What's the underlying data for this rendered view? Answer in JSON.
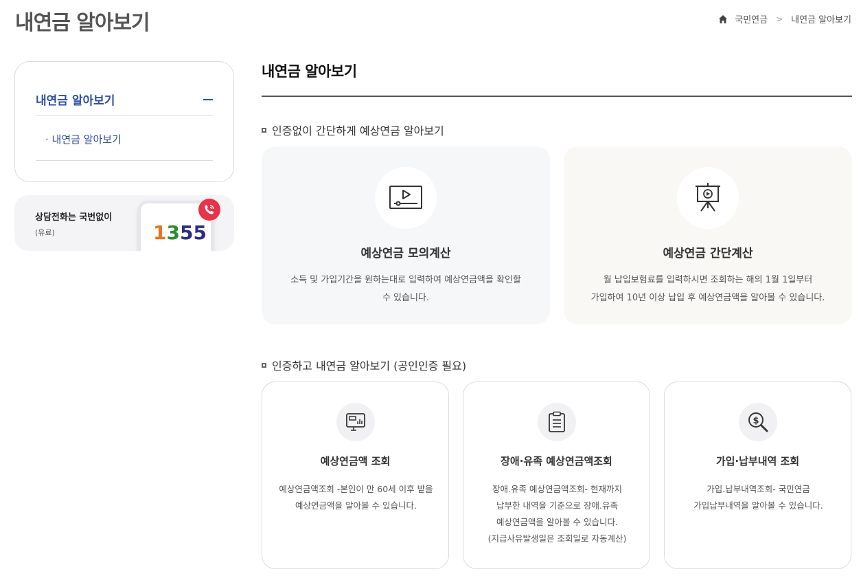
{
  "header": {
    "title": "내연금 알아보기",
    "breadcrumb": {
      "home_icon": "home-icon",
      "level1": "국민연금",
      "separator": ">",
      "level2": "내연금 알아보기"
    }
  },
  "sidebar": {
    "menu_title": "내연금 알아보기",
    "collapse_icon": "minus-icon",
    "sub_item": "· 내연금 알아보기"
  },
  "call_box": {
    "line1": "상담전화는 국번없이",
    "line2": "(유료)",
    "number_part1": "1",
    "number_part2": "3",
    "number_part3": "55",
    "icon": "phone-call-icon",
    "colors": {
      "badge": "#e8334a",
      "digit1": "#e2761b",
      "digit2": "#2e8b2e",
      "digit3": "#2a2f83"
    }
  },
  "main": {
    "title": "내연금 알아보기",
    "section1": {
      "title": "인증없이 간단하게 예상연금 알아보기",
      "cards": [
        {
          "icon": "video-player-icon",
          "title": "예상연금 모의계산",
          "desc_line1": "소득 및 가입기간을 원하는대로 입력하여 예상연금액을 확인할",
          "desc_line2": "수 있습니다."
        },
        {
          "icon": "presentation-board-icon",
          "title": "예상연금 간단계산",
          "desc_line1": "월 납입보험료를 입력하시면 조회하는 해의 1월 1일부터",
          "desc_line2": "가입하여 10년 이상 납입 후 예상연금액을 알아볼 수 있습니다."
        }
      ]
    },
    "section2": {
      "title": "인증하고 내연금 알아보기 (공인인증 필요)",
      "cards": [
        {
          "icon": "monitor-chart-icon",
          "title": "예상연금액 조회",
          "lines": [
            "예상연금액조회 -본인이 만 60세 이후 받을",
            "예상연금액을 알아볼 수 있습니다."
          ]
        },
        {
          "icon": "clipboard-icon",
          "title": "장애·유족 예상연금액조회",
          "lines": [
            "장애.유족 예상연금액조회- 현재까지",
            "납부한 내역을 기준으로 장애.유족",
            "예상연금액을 알아볼 수 있습니다.",
            "(지급사유발생일은 조회일로 자동계산)"
          ]
        },
        {
          "icon": "dollar-search-icon",
          "title": "가입·납부내역 조회",
          "lines": [
            "가입.납부내역조회- 국민연금",
            "가입납부내역을 알아볼 수 있습니다."
          ]
        }
      ]
    }
  },
  "colors": {
    "accent": "#2d4ea2"
  }
}
